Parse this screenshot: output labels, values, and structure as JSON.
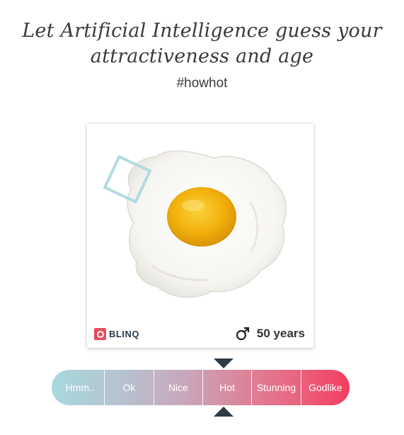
{
  "header": {
    "title_line1": "Let Artificial Intelligence guess your",
    "title_line2": "attractiveness and age",
    "hashtag": "#howhot"
  },
  "result_card": {
    "image_subject": "fried egg photo",
    "brand": "BLINQ",
    "gender_icon": "male-symbol-icon",
    "age_label": "50 years"
  },
  "rating_scale": {
    "levels": [
      "Hmm..",
      "Ok",
      "Nice",
      "Hot",
      "Stunning",
      "Godlike"
    ],
    "selected": "Hot",
    "colors": {
      "start": "#a6d9dc",
      "end": "#f23d60",
      "pointer": "#2d3b48"
    }
  }
}
